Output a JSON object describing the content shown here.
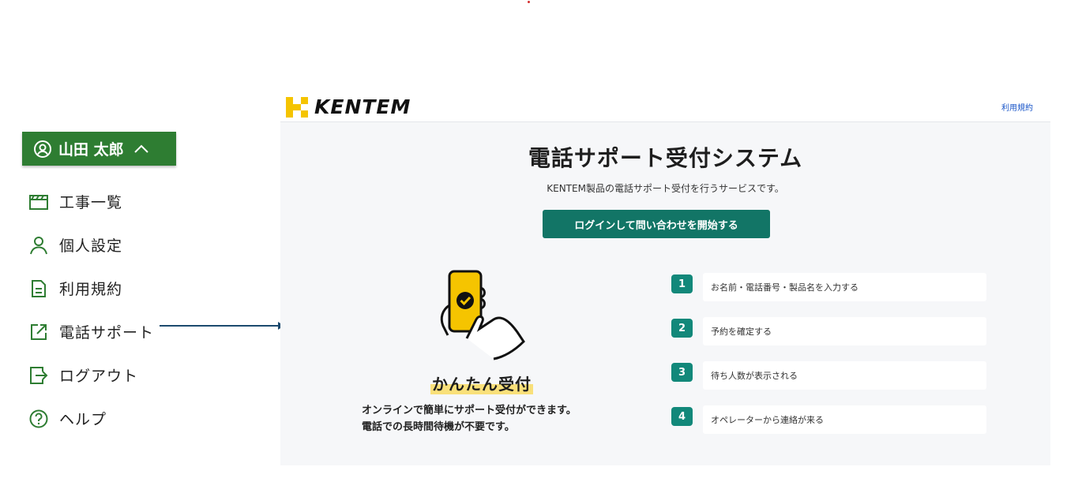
{
  "user_menu": {
    "user_name": "山田 太郎",
    "items": [
      {
        "label": "工事一覧",
        "icon": "clapperboard-icon"
      },
      {
        "label": "個人設定",
        "icon": "person-icon"
      },
      {
        "label": "利用規約",
        "icon": "document-icon"
      },
      {
        "label": "電話サポート",
        "icon": "external-link-icon"
      },
      {
        "label": "ログアウト",
        "icon": "logout-icon"
      },
      {
        "label": "ヘルプ",
        "icon": "help-icon"
      }
    ]
  },
  "site": {
    "brand": "KENTEM",
    "terms_link": "利用規約",
    "title": "電話サポート受付システム",
    "subtitle": "KENTEM製品の電話サポート受付を行うサービスです。",
    "login_button": "ログインして問い合わせを開始する",
    "easy_heading": "かんたん受付",
    "easy_desc_line1": "オンラインで簡単にサポート受付ができます。",
    "easy_desc_line2": "電話での長時間待機が不要です。",
    "steps": [
      {
        "num": "1",
        "label": "お名前・電話番号・製品名を入力する"
      },
      {
        "num": "2",
        "label": "予約を確定する"
      },
      {
        "num": "3",
        "label": "待ち人数が表示される"
      },
      {
        "num": "4",
        "label": "オペレーターから連絡が来る"
      }
    ]
  },
  "colors": {
    "menu_green": "#2e7d32",
    "button_teal": "#127566",
    "step_teal": "#12887a",
    "brand_yellow": "#f5c400",
    "arrow": "#1c4a6e"
  }
}
